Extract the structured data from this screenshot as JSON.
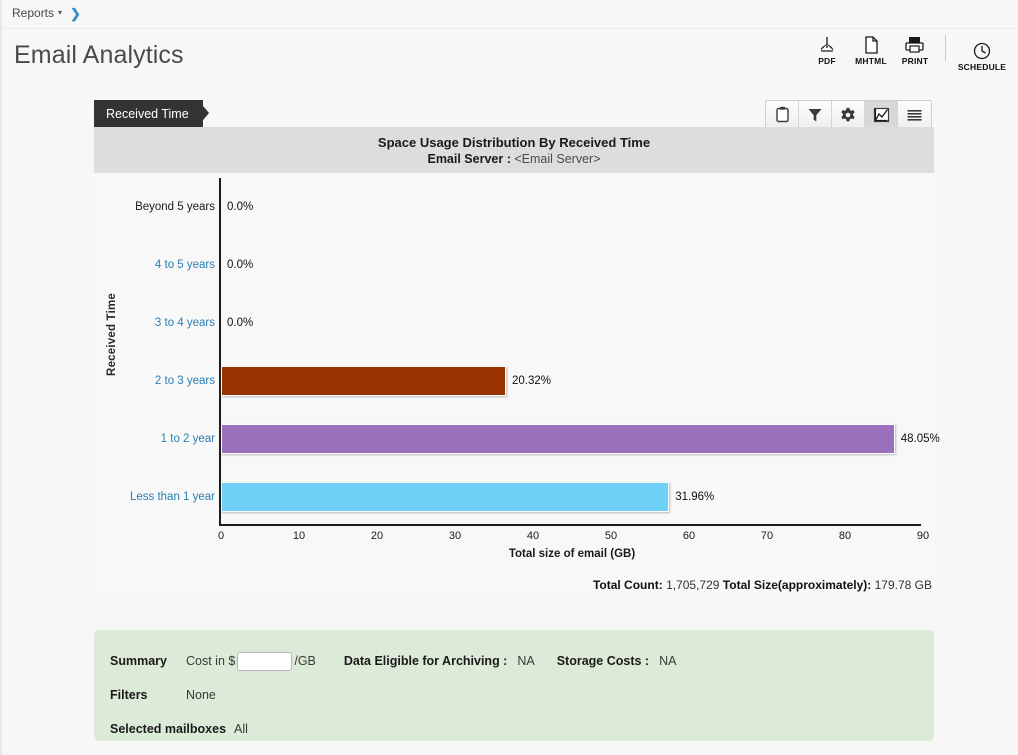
{
  "breadcrumb": {
    "label": "Reports",
    "caret": "▾",
    "separator": "❯"
  },
  "page_title": "Email Analytics",
  "actions": [
    {
      "name": "pdf",
      "caption": "PDF"
    },
    {
      "name": "mhtml",
      "caption": "MHTML"
    },
    {
      "name": "print",
      "caption": "PRINT"
    },
    {
      "name": "schedule",
      "caption": "SCHEDULE"
    }
  ],
  "tab": {
    "label": "Received Time"
  },
  "chart_toolbar": [
    {
      "name": "clipboard-icon",
      "active": false
    },
    {
      "name": "filter-icon",
      "active": false
    },
    {
      "name": "gear-icon",
      "active": false
    },
    {
      "name": "chart-icon",
      "active": true
    },
    {
      "name": "list-icon",
      "active": false
    }
  ],
  "chart_header": {
    "title": "Space Usage Distribution By Received Time",
    "server_label": "Email Server :",
    "server_value": "<Email Server>"
  },
  "chart_data": {
    "type": "bar",
    "orientation": "horizontal",
    "title": "Space Usage Distribution By Received Time",
    "subtitle": "Email Server : <Email Server>",
    "xlabel": "Total size of email (GB)",
    "ylabel": "Received Time",
    "xlim": [
      0,
      90
    ],
    "xticks": [
      0,
      10,
      20,
      30,
      40,
      50,
      60,
      70,
      80,
      90
    ],
    "grid": false,
    "legend": "none",
    "categories": [
      "Beyond 5 years",
      "4 to 5 years",
      "3 to 4 years",
      "2 to 3 years",
      "1 to 2 year",
      "Less than 1 year"
    ],
    "values": [
      0,
      0,
      0,
      36.54,
      86.38,
      57.47
    ],
    "labels": [
      "0.0%",
      "0.0%",
      "0.0%",
      "20.32%",
      "48.05%",
      "31.96%"
    ],
    "percent_values": [
      0.0,
      0.0,
      0.0,
      20.32,
      48.05,
      31.96
    ],
    "colors": [
      "#993300",
      "#993300",
      "#993300",
      "#993300",
      "#9a70bd",
      "#6fd0f7"
    ],
    "category_links": [
      false,
      true,
      true,
      true,
      true,
      true
    ]
  },
  "totals": {
    "count_label": "Total Count:",
    "count_value": "1,705,729",
    "size_label": "Total Size(approximately):",
    "size_value": "179.78 GB"
  },
  "summary": {
    "summary_label": "Summary",
    "cost_label": "Cost in $",
    "cost_value": "",
    "cost_placeholder": "",
    "cost_unit": "/GB",
    "archiving_label": "Data Eligible for Archiving :",
    "archiving_value": "NA",
    "storage_label": "Storage Costs :",
    "storage_value": "NA",
    "filters_label": "Filters",
    "filters_value": "None",
    "mailboxes_label": "Selected mailboxes",
    "mailboxes_value": "All"
  }
}
